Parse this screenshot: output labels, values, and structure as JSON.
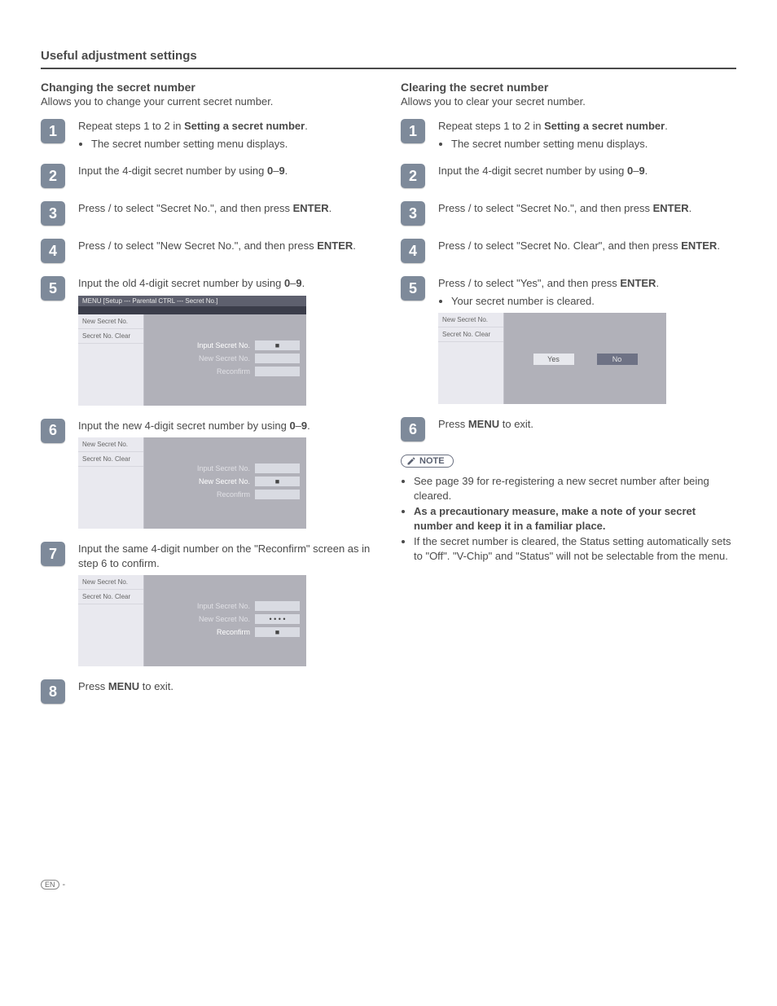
{
  "title": "Useful adjustment settings",
  "left": {
    "heading": "Changing the secret number",
    "sub": "Allows you to change your current secret number.",
    "steps": {
      "s1": {
        "text_a": "Repeat steps 1 to 2 in ",
        "text_b": "Setting a secret number",
        "text_c": ".",
        "bullet": "The secret number setting menu displays."
      },
      "s2": {
        "text_a": "Input the 4-digit secret number by using ",
        "text_b": "0",
        "text_c": "–",
        "text_d": "9",
        "text_e": "."
      },
      "s3": {
        "text_a": "Press ",
        "text_b": " / ",
        "text_c": " to select \"Secret No.\", and then press ",
        "text_d": "ENTER",
        "text_e": "."
      },
      "s4": {
        "text_a": "Press ",
        "text_b": " / ",
        "text_c": " to select \"New Secret No.\", and then press ",
        "text_d": "ENTER",
        "text_e": "."
      },
      "s5": {
        "text_a": "Input the old 4-digit secret number by using ",
        "text_b": "0",
        "text_c": "–",
        "text_d": "9",
        "text_e": "."
      },
      "s6": {
        "text_a": "Input the new 4-digit secret number by using ",
        "text_b": "0",
        "text_c": "–",
        "text_d": "9",
        "text_e": "."
      },
      "s7": {
        "text": "Input the same 4-digit number on the \"Reconfirm\" screen as in step 6 to confirm."
      },
      "s8": {
        "text_a": "Press ",
        "text_b": "MENU",
        "text_c": " to exit."
      }
    },
    "osd": {
      "breadcrumb": "MENU   [Setup --- Parental CTRL --- Secret No.]",
      "left1": "New Secret No.",
      "left2": "Secret No. Clear",
      "row1": "Input Secret No.",
      "row2": "New Secret No.",
      "row3": "Reconfirm",
      "block": "■",
      "dots": "•  •  •  •"
    }
  },
  "right": {
    "heading": "Clearing the secret number",
    "sub": "Allows you to clear your secret number.",
    "steps": {
      "s1": {
        "text_a": "Repeat steps 1 to 2 in ",
        "text_b": "Setting a secret number",
        "text_c": ".",
        "bullet": "The secret number setting menu displays."
      },
      "s2": {
        "text_a": "Input the 4-digit secret number by using ",
        "text_b": "0",
        "text_c": "–",
        "text_d": "9",
        "text_e": "."
      },
      "s3": {
        "text_a": "Press ",
        "text_b": " / ",
        "text_c": " to select \"Secret No.\", and then press ",
        "text_d": "ENTER",
        "text_e": "."
      },
      "s4": {
        "text_a": "Press ",
        "text_b": " / ",
        "text_c": " to select \"Secret No. Clear\", and then press ",
        "text_d": "ENTER",
        "text_e": "."
      },
      "s5": {
        "text_a": "Press ",
        "text_b": " / ",
        "text_c": " to select \"Yes\", and then press ",
        "text_d": "ENTER",
        "text_e": ".",
        "bullet": "Your secret number is cleared."
      },
      "s6": {
        "text_a": "Press ",
        "text_b": "MENU",
        "text_c": " to exit."
      }
    },
    "osd": {
      "left1": "New Secret No.",
      "left2": "Secret No. Clear",
      "yes": "Yes",
      "no": "No"
    },
    "note_label": "NOTE",
    "notes": {
      "n1": "See page 39 for re-registering a new secret number after being cleared.",
      "n2": "As a precautionary measure, make a note of your secret number and keep it in a familiar place.",
      "n3": "If the secret number is cleared, the Status setting automatically sets to \"Off\". \"V-Chip\" and \"Status\" will not be selectable from the menu."
    }
  },
  "footer": {
    "lang": "EN",
    "dash": "-"
  },
  "nums": {
    "1": "1",
    "2": "2",
    "3": "3",
    "4": "4",
    "5": "5",
    "6": "6",
    "7": "7",
    "8": "8"
  }
}
